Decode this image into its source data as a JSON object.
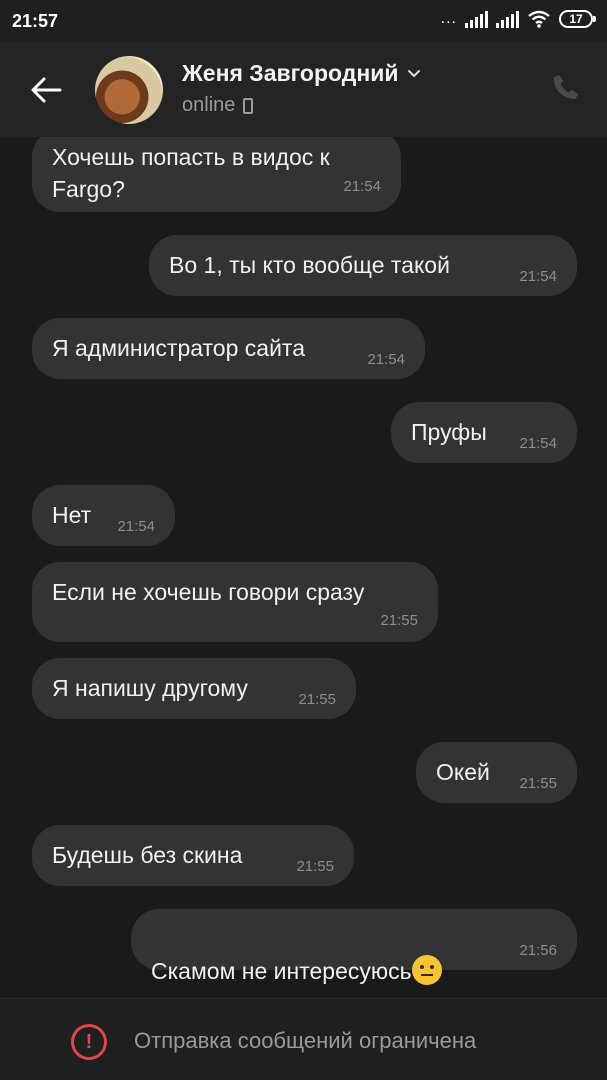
{
  "statusbar": {
    "time": "21:57",
    "dots": "...",
    "battery": "17"
  },
  "header": {
    "name": "Женя Завгородний",
    "status": "online"
  },
  "messages": [
    {
      "side": "in",
      "text": "Хочешь попасть в видос к\nFargo?",
      "time": "21:54"
    },
    {
      "side": "out",
      "text": "Во 1, ты кто вообще такой",
      "time": "21:54"
    },
    {
      "side": "in",
      "text": "Я администратор сайта",
      "time": "21:54"
    },
    {
      "side": "out",
      "text": "Пруфы",
      "time": "21:54"
    },
    {
      "side": "in",
      "text": "Нет",
      "time": "21:54"
    },
    {
      "side": "in",
      "text": "Если не хочешь говори сразу",
      "time": "21:55"
    },
    {
      "side": "in",
      "text": "Я напишу другому",
      "time": "21:55"
    },
    {
      "side": "out",
      "text": "Окей",
      "time": "21:55"
    },
    {
      "side": "in",
      "text": "Будешь без скина",
      "time": "21:55"
    },
    {
      "side": "out",
      "text": "Скамом не интересуюсь",
      "emoji": "neutral-face-emoji",
      "time": "21:56"
    }
  ],
  "footer": {
    "notice": "Отправка сообщений ограничена"
  },
  "colors": {
    "background": "#1a1a1a",
    "bubble": "#333335",
    "header": "#242424",
    "warning": "#e0464a"
  }
}
